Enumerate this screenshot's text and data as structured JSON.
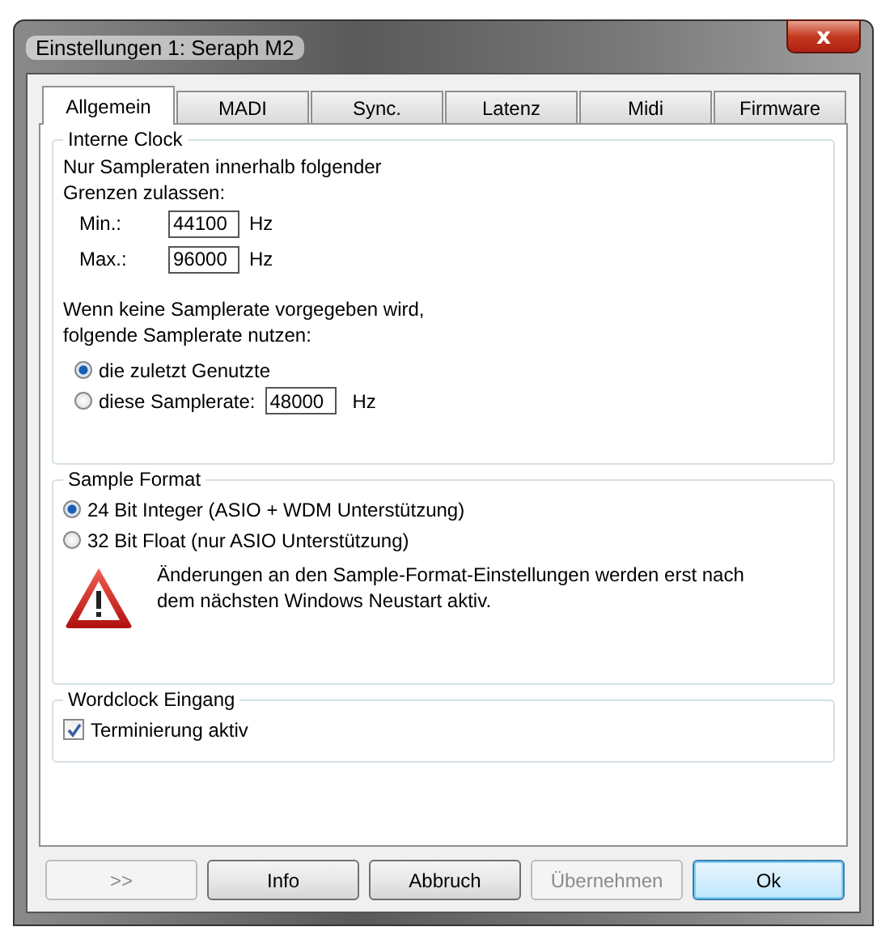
{
  "window": {
    "title": "Einstellungen 1: Seraph M2",
    "close": "x"
  },
  "tabs": [
    {
      "label": "Allgemein",
      "selected": true
    },
    {
      "label": "MADI",
      "selected": false
    },
    {
      "label": "Sync.",
      "selected": false
    },
    {
      "label": "Latenz",
      "selected": false
    },
    {
      "label": "Midi",
      "selected": false
    },
    {
      "label": "Firmware",
      "selected": false
    }
  ],
  "interne_clock": {
    "title": "Interne Clock",
    "limits_text": "Nur Sampleraten innerhalb folgender Grenzen zulassen:",
    "limits": [
      {
        "label": "Min.:",
        "value": "44100",
        "unit": "Hz"
      },
      {
        "label": "Max.:",
        "value": "96000",
        "unit": "Hz"
      }
    ],
    "default_text": "Wenn keine Samplerate vorgegeben wird, folgende Samplerate nutzen:",
    "options": [
      {
        "label": "die zuletzt Genutzte",
        "selected": true
      },
      {
        "label": "diese Samplerate:",
        "selected": false,
        "value": "48000",
        "unit": "Hz"
      }
    ]
  },
  "sample_format": {
    "title": "Sample Format",
    "options": [
      {
        "label": "24 Bit Integer (ASIO + WDM Unterstützung)",
        "selected": true
      },
      {
        "label": "32 Bit Float (nur ASIO Unterstützung)",
        "selected": false
      }
    ],
    "warning": "Änderungen an den Sample-Format-Einstellungen werden erst nach dem nächsten Windows Neustart aktiv."
  },
  "wordclock": {
    "title": "Wordclock Eingang",
    "checkbox": {
      "label": "Terminierung aktiv",
      "checked": true
    }
  },
  "buttons": [
    {
      "label": ">>",
      "disabled": true,
      "default": false
    },
    {
      "label": "Info",
      "disabled": false,
      "default": false
    },
    {
      "label": "Abbruch",
      "disabled": false,
      "default": false
    },
    {
      "label": "Übernehmen",
      "disabled": true,
      "default": false
    },
    {
      "label": "Ok",
      "disabled": false,
      "default": true
    }
  ]
}
